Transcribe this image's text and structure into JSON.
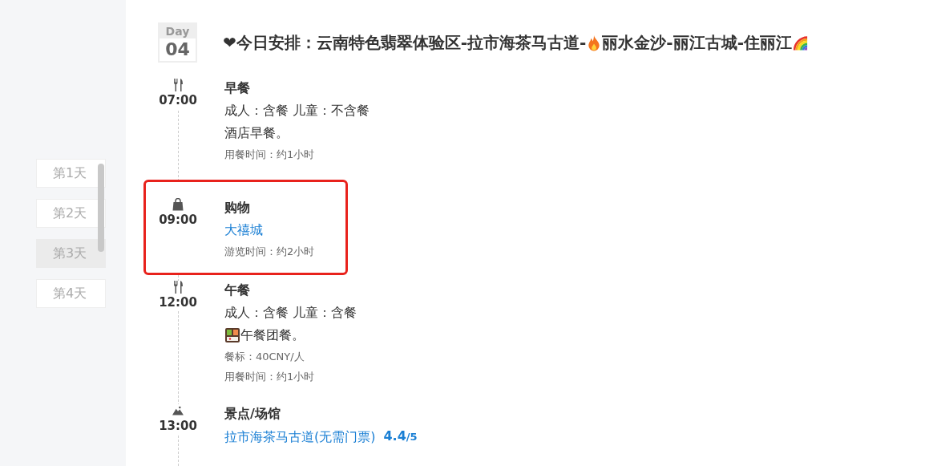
{
  "sidebar": {
    "days": [
      {
        "label": "第1天",
        "selected": false
      },
      {
        "label": "第2天",
        "selected": false
      },
      {
        "label": "第3天",
        "selected": true
      },
      {
        "label": "第4天",
        "selected": false
      }
    ]
  },
  "day_badge": {
    "label": "Day",
    "number": "04"
  },
  "title": [
    {
      "kind": "text",
      "text": "❤今日安排：云南特色翡翠体验区-拉市海茶马古道-"
    },
    {
      "kind": "flame"
    },
    {
      "kind": "text",
      "text": "丽水金沙-丽江古城-住丽江"
    },
    {
      "kind": "rainbow"
    }
  ],
  "items": [
    {
      "kind": "meal",
      "time": "07:00",
      "title": "早餐",
      "highlighted": false,
      "lines": [
        {
          "kind": "text",
          "text": "成人：含餐 儿童：不含餐"
        },
        {
          "kind": "text",
          "text": "酒店早餐。"
        },
        {
          "kind": "note",
          "text": "用餐时间：约1小时"
        }
      ]
    },
    {
      "kind": "shopping",
      "time": "09:00",
      "title": "购物",
      "highlighted": true,
      "lines": [
        {
          "kind": "link",
          "text": "大禧城"
        },
        {
          "kind": "note",
          "text": "游览时间：约2小时"
        }
      ]
    },
    {
      "kind": "meal",
      "time": "12:00",
      "title": "午餐",
      "highlighted": false,
      "lines": [
        {
          "kind": "text",
          "text": "成人：含餐 儿童：含餐"
        },
        {
          "kind": "bento",
          "text": "午餐团餐。"
        },
        {
          "kind": "note",
          "text": "餐标：40CNY/人"
        },
        {
          "kind": "note",
          "text": "用餐时间：约1小时"
        }
      ]
    },
    {
      "kind": "sight",
      "time": "13:00",
      "title": "景点/场馆",
      "highlighted": false,
      "lines": [
        {
          "kind": "link",
          "text": "拉市海茶马古道(无需门票)",
          "rating": "4.4",
          "scale": "/5"
        }
      ]
    }
  ]
}
